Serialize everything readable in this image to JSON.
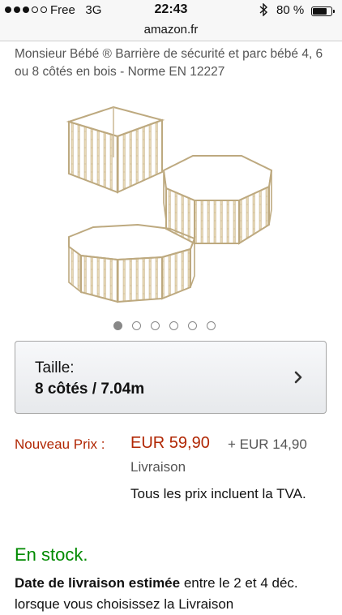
{
  "status_bar": {
    "carrier": "Free",
    "network": "3G",
    "time": "22:43",
    "battery_percent": "80 %",
    "battery_level": 0.8,
    "signal_bars_filled": 3,
    "signal_bars_total": 5
  },
  "browser": {
    "url": "amazon.fr"
  },
  "product": {
    "title": "Monsieur Bébé ® Barrière de sécurité et parc bébé 4, 6 ou 8 côtés en bois - Norme EN 12227",
    "image_alt": "Barrière de sécurité en bois - 4, 6 et 8 côtés"
  },
  "carousel": {
    "count": 6,
    "active_index": 0
  },
  "variation": {
    "label": "Taille:",
    "value": "8 côtés / 7.04m"
  },
  "price": {
    "label": "Nouveau Prix :",
    "amount": "EUR 59,90",
    "shipping_line1": "+ EUR 14,90",
    "shipping_line2": "Livraison",
    "tax_note": "Tous les prix incluent la TVA.",
    "color": "#b12704"
  },
  "availability": {
    "stock": "En stock.",
    "color": "#008a00"
  },
  "delivery": {
    "bold_part": "Date de livraison estimée",
    "rest": " entre le 2 et 4 déc. lorsque vous choisissez la Livraison"
  }
}
